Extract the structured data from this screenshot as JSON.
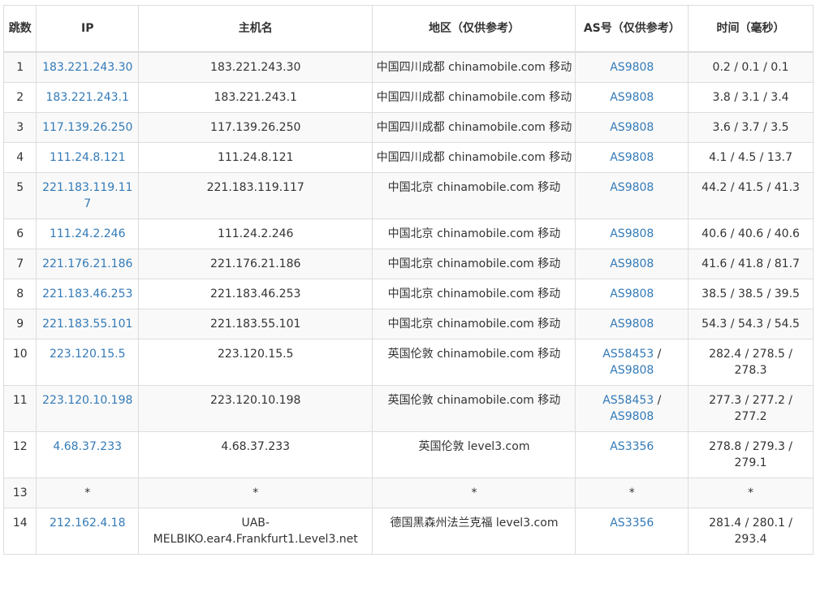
{
  "headers": {
    "hop": "跳数",
    "ip": "IP",
    "hostname": "主机名",
    "region": "地区（仅供参考）",
    "as": "AS号（仅供参考）",
    "time": "时间（毫秒）"
  },
  "rows": [
    {
      "hop": "1",
      "ip": "183.221.243.30",
      "hostname": "183.221.243.30",
      "region": "中国四川成都 chinamobile.com 移动",
      "as": [
        "AS9808"
      ],
      "time": "0.2 / 0.1 / 0.1"
    },
    {
      "hop": "2",
      "ip": "183.221.243.1",
      "hostname": "183.221.243.1",
      "region": "中国四川成都 chinamobile.com 移动",
      "as": [
        "AS9808"
      ],
      "time": "3.8 / 3.1 / 3.4"
    },
    {
      "hop": "3",
      "ip": "117.139.26.250",
      "hostname": "117.139.26.250",
      "region": "中国四川成都 chinamobile.com 移动",
      "as": [
        "AS9808"
      ],
      "time": "3.6 / 3.7 / 3.5"
    },
    {
      "hop": "4",
      "ip": "111.24.8.121",
      "hostname": "111.24.8.121",
      "region": "中国四川成都 chinamobile.com 移动",
      "as": [
        "AS9808"
      ],
      "time": "4.1 / 4.5 / 13.7"
    },
    {
      "hop": "5",
      "ip": "221.183.119.117",
      "hostname": "221.183.119.117",
      "region": "中国北京 chinamobile.com 移动",
      "as": [
        "AS9808"
      ],
      "time": "44.2 / 41.5 / 41.3"
    },
    {
      "hop": "6",
      "ip": "111.24.2.246",
      "hostname": "111.24.2.246",
      "region": "中国北京 chinamobile.com 移动",
      "as": [
        "AS9808"
      ],
      "time": "40.6 / 40.6 / 40.6"
    },
    {
      "hop": "7",
      "ip": "221.176.21.186",
      "hostname": "221.176.21.186",
      "region": "中国北京 chinamobile.com 移动",
      "as": [
        "AS9808"
      ],
      "time": "41.6 / 41.8 / 81.7"
    },
    {
      "hop": "8",
      "ip": "221.183.46.253",
      "hostname": "221.183.46.253",
      "region": "中国北京 chinamobile.com 移动",
      "as": [
        "AS9808"
      ],
      "time": "38.5 / 38.5 / 39.5"
    },
    {
      "hop": "9",
      "ip": "221.183.55.101",
      "hostname": "221.183.55.101",
      "region": "中国北京 chinamobile.com 移动",
      "as": [
        "AS9808"
      ],
      "time": "54.3 / 54.3 / 54.5"
    },
    {
      "hop": "10",
      "ip": "223.120.15.5",
      "hostname": "223.120.15.5",
      "region": "英国伦敦 chinamobile.com 移动",
      "as": [
        "AS58453",
        "AS9808"
      ],
      "time": "282.4 / 278.5 / 278.3"
    },
    {
      "hop": "11",
      "ip": "223.120.10.198",
      "hostname": "223.120.10.198",
      "region": "英国伦敦 chinamobile.com 移动",
      "as": [
        "AS58453",
        "AS9808"
      ],
      "time": "277.3 / 277.2 / 277.2"
    },
    {
      "hop": "12",
      "ip": "4.68.37.233",
      "hostname": "4.68.37.233",
      "region": "英国伦敦 level3.com",
      "as": [
        "AS3356"
      ],
      "time": "278.8 / 279.3 / 279.1"
    },
    {
      "hop": "13",
      "ip": "*",
      "hostname": "*",
      "region": "*",
      "as": [
        "*"
      ],
      "time": "*"
    },
    {
      "hop": "14",
      "ip": "212.162.4.18",
      "hostname": "UAB-MELBIKO.ear4.Frankfurt1.Level3.net",
      "region": "德国黑森州法兰克福 level3.com",
      "as": [
        "AS3356"
      ],
      "time": "281.4 / 280.1 / 293.4"
    }
  ],
  "colors": {
    "link": "#337ab7",
    "text": "#333333",
    "border": "#dddddd",
    "stripe": "#f9f9f9"
  }
}
